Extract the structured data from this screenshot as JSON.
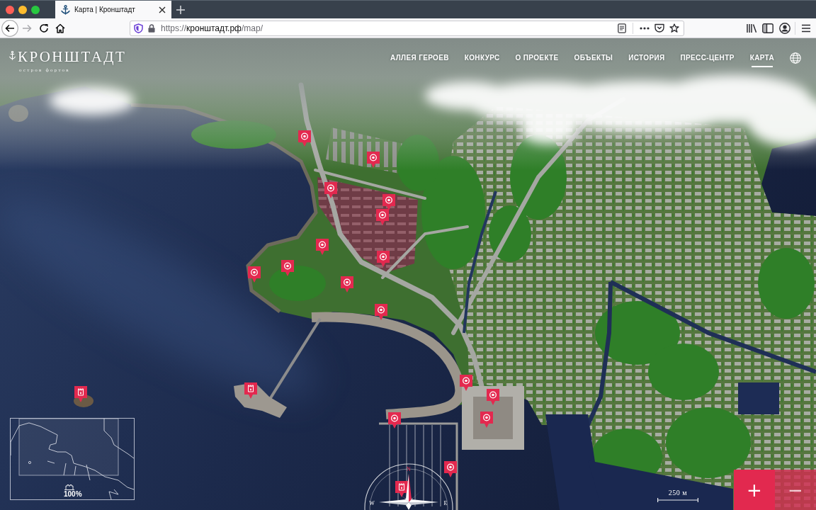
{
  "browser": {
    "tabs": [
      {
        "title": "Карта | Кронштадт",
        "selected": true
      }
    ],
    "back": {
      "disabled": false
    },
    "forward": {
      "disabled": true
    },
    "address_bar": {
      "scheme": "https://",
      "host": "кронштадт.рф",
      "path": "/map/"
    }
  },
  "header": {
    "logo": {
      "name": "КРОНШТАДТ",
      "tagline": "остров фортов"
    },
    "nav": [
      {
        "label": "АЛЛЕЯ ГЕРОЕВ",
        "selected": false
      },
      {
        "label": "КОНКУРС",
        "selected": false
      },
      {
        "label": "О ПРОЕКТЕ",
        "selected": false
      },
      {
        "label": "ОБЪЕКТЫ",
        "selected": false
      },
      {
        "label": "ИСТОРИЯ",
        "selected": false
      },
      {
        "label": "ПРЕСС-ЦЕНТР",
        "selected": false
      },
      {
        "label": "КАРТА",
        "selected": true
      }
    ]
  },
  "map": {
    "minimap": {
      "zoom": "100%"
    },
    "compass": [
      {
        "kind": "north",
        "label": "N"
      },
      {
        "kind": "west",
        "label": "W"
      },
      {
        "kind": "east",
        "label": "E"
      }
    ],
    "scale": {
      "label": "250 м"
    },
    "zoom_in": {
      "label": "+",
      "disabled": false
    },
    "zoom_out": {
      "label": "−",
      "disabled": true
    }
  }
}
